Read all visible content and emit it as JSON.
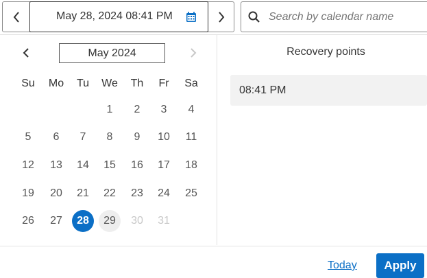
{
  "date_picker": {
    "value": "May 28, 2024 08:41 PM",
    "prev_icon": "chevron-left-icon",
    "next_icon": "chevron-right-icon",
    "calendar_icon": "calendar-icon"
  },
  "search": {
    "placeholder": "Search by calendar name",
    "value": "",
    "icon": "search-icon"
  },
  "calendar": {
    "month_label": "May 2024",
    "weekdays": [
      "Su",
      "Mo",
      "Tu",
      "We",
      "Th",
      "Fr",
      "Sa"
    ],
    "weeks": [
      [
        "",
        "",
        "",
        "1",
        "2",
        "3",
        "4"
      ],
      [
        "5",
        "6",
        "7",
        "8",
        "9",
        "10",
        "11"
      ],
      [
        "12",
        "13",
        "14",
        "15",
        "16",
        "17",
        "18"
      ],
      [
        "19",
        "20",
        "21",
        "22",
        "23",
        "24",
        "25"
      ],
      [
        "26",
        "27",
        "28",
        "29",
        "30",
        "31",
        ""
      ]
    ],
    "selected_day": "28",
    "hovered_day": "29",
    "disabled_days": [
      "30",
      "31"
    ],
    "accent_color": "#0b6fc6"
  },
  "recovery_points": {
    "title": "Recovery points",
    "items": [
      "08:41 PM"
    ]
  },
  "footer": {
    "today_label": "Today",
    "apply_label": "Apply"
  }
}
